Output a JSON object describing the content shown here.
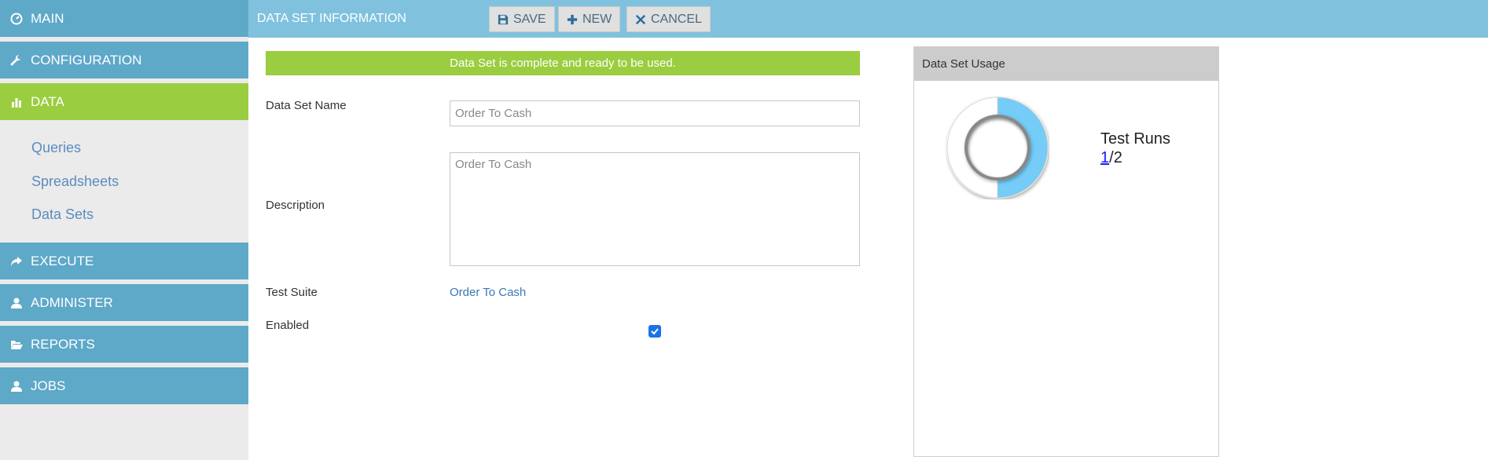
{
  "sidebar": {
    "nav": [
      {
        "label": "MAIN",
        "icon": "dashboard-icon"
      },
      {
        "label": "CONFIGURATION",
        "icon": "wrench-icon"
      },
      {
        "label": "DATA",
        "icon": "bar-chart-icon"
      },
      {
        "label": "EXECUTE",
        "icon": "share-arrow-icon"
      },
      {
        "label": "ADMINISTER",
        "icon": "user-icon"
      },
      {
        "label": "REPORTS",
        "icon": "folder-open-icon"
      },
      {
        "label": "JOBS",
        "icon": "user-icon"
      }
    ],
    "data_items": [
      "Queries",
      "Spreadsheets",
      "Data Sets"
    ]
  },
  "toolbar": {
    "title": "DATA SET INFORMATION",
    "save_label": "SAVE",
    "new_label": "NEW",
    "cancel_label": "CANCEL"
  },
  "form": {
    "status_message": "Data Set is complete and ready to be used.",
    "name_label": "Data Set Name",
    "name_value": "Order To Cash",
    "description_label": "Description",
    "description_value": "Order To Cash",
    "test_suite_label": "Test Suite",
    "test_suite_value": "Order To Cash",
    "enabled_label": "Enabled",
    "enabled": true
  },
  "usage": {
    "title": "Data Set Usage",
    "stat_label": "Test Runs",
    "used": "1",
    "total": "2",
    "fraction": 0.5,
    "accent_color": "#74ccf7"
  }
}
